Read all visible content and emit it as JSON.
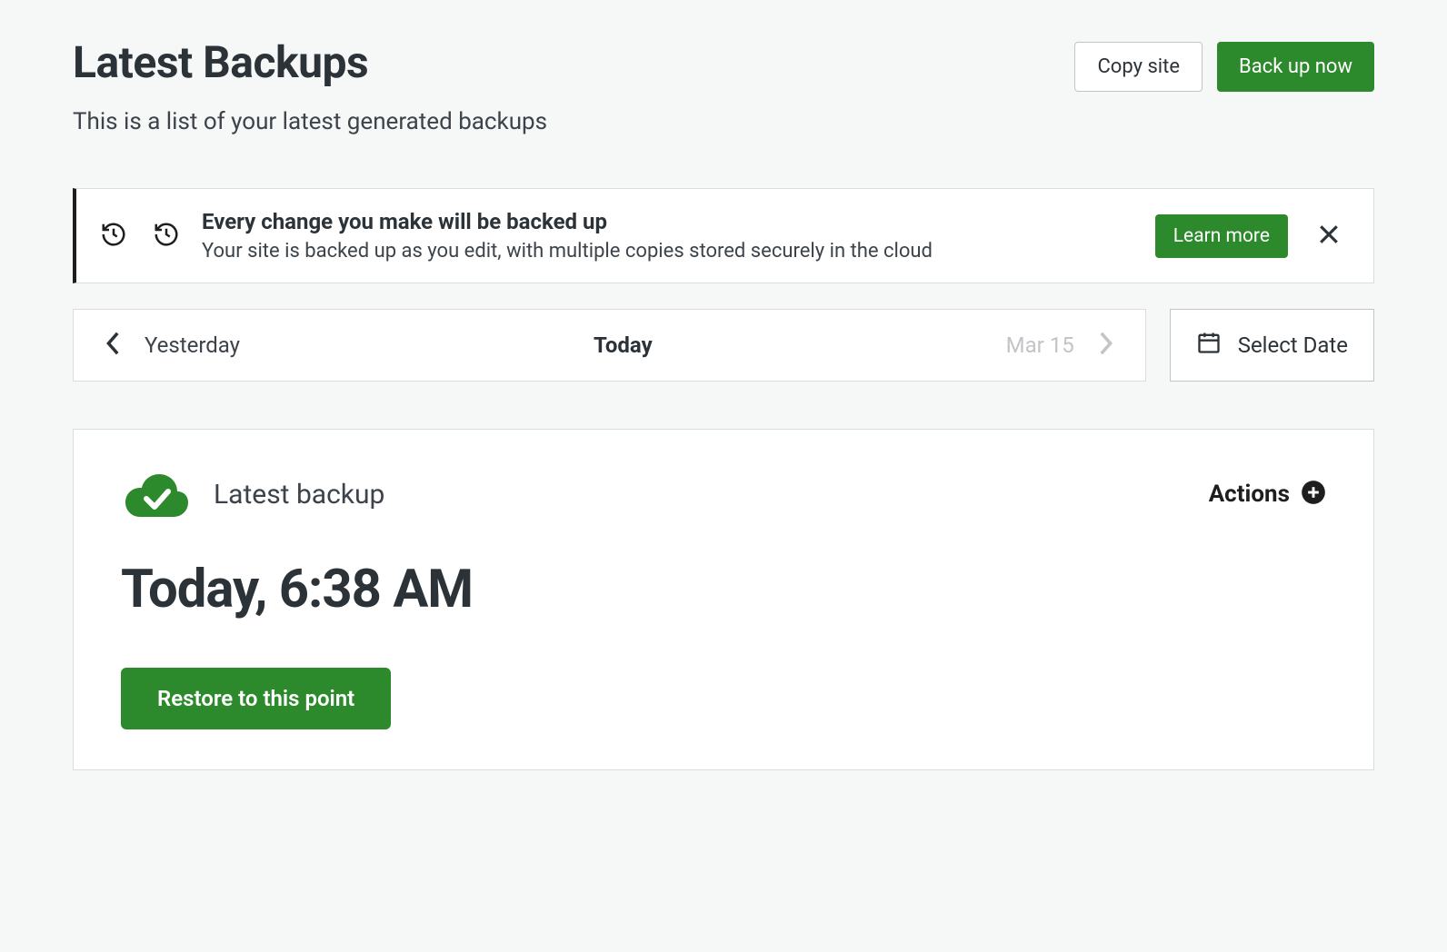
{
  "header": {
    "title": "Latest Backups",
    "subtitle": "This is a list of your latest generated backups",
    "copy_site_label": "Copy site",
    "back_up_now_label": "Back up now"
  },
  "notice": {
    "title": "Every change you make will be backed up",
    "description": "Your site is backed up as you edit, with multiple copies stored securely in the cloud",
    "learn_more_label": "Learn more"
  },
  "date_nav": {
    "prev_label": "Yesterday",
    "current_label": "Today",
    "next_label": "Mar 15",
    "select_date_label": "Select Date"
  },
  "backup": {
    "label": "Latest backup",
    "actions_label": "Actions",
    "timestamp": "Today, 6:38 AM",
    "restore_label": "Restore to this point"
  }
}
